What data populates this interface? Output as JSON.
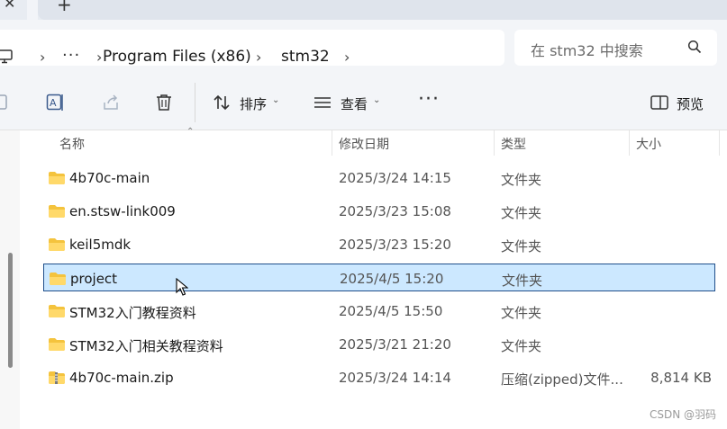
{
  "tabbar": {
    "close_glyph": "✕",
    "add_glyph": "+"
  },
  "address_bar": {
    "root_icon": "monitor-icon",
    "overflow": "···",
    "crumbs": [
      "Program Files (x86)",
      "stm32"
    ],
    "separator": "›"
  },
  "search": {
    "placeholder": "在 stm32 中搜索",
    "icon": "search-icon"
  },
  "toolbar": {
    "sort_label": "排序",
    "view_label": "查看",
    "more_label": "···",
    "preview_label": "预览",
    "icons": [
      "copy-icon",
      "rename-icon",
      "share-icon",
      "delete-icon",
      "sort-icon",
      "view-icon",
      "more-icon",
      "preview-pane-icon"
    ]
  },
  "columns": {
    "name": "名称",
    "modified": "修改日期",
    "type": "类型",
    "size": "大小"
  },
  "files": [
    {
      "name": "4b70c-main",
      "modified": "2025/3/24 14:15",
      "type": "文件夹",
      "size": "",
      "icon": "folder-icon"
    },
    {
      "name": "en.stsw-link009",
      "modified": "2025/3/23 15:08",
      "type": "文件夹",
      "size": "",
      "icon": "folder-icon"
    },
    {
      "name": "keil5mdk",
      "modified": "2025/3/23 15:20",
      "type": "文件夹",
      "size": "",
      "icon": "folder-icon"
    },
    {
      "name": "project",
      "modified": "2025/4/5 15:20",
      "type": "文件夹",
      "size": "",
      "icon": "folder-icon",
      "selected": true
    },
    {
      "name": "STM32入门教程资料",
      "modified": "2025/4/5 15:50",
      "type": "文件夹",
      "size": "",
      "icon": "folder-icon"
    },
    {
      "name": "STM32入门相关教程资料",
      "modified": "2025/3/21 21:20",
      "type": "文件夹",
      "size": "",
      "icon": "folder-icon"
    },
    {
      "name": "4b70c-main.zip",
      "modified": "2025/3/24 14:14",
      "type": "压缩(zipped)文件...",
      "size": "8,814 KB",
      "icon": "zip-folder-icon"
    }
  ],
  "watermark": "CSDN @羽码",
  "colors": {
    "selection_bg": "#cce8ff",
    "selection_border": "#1f4e8a",
    "folder": "#f4c33d"
  }
}
